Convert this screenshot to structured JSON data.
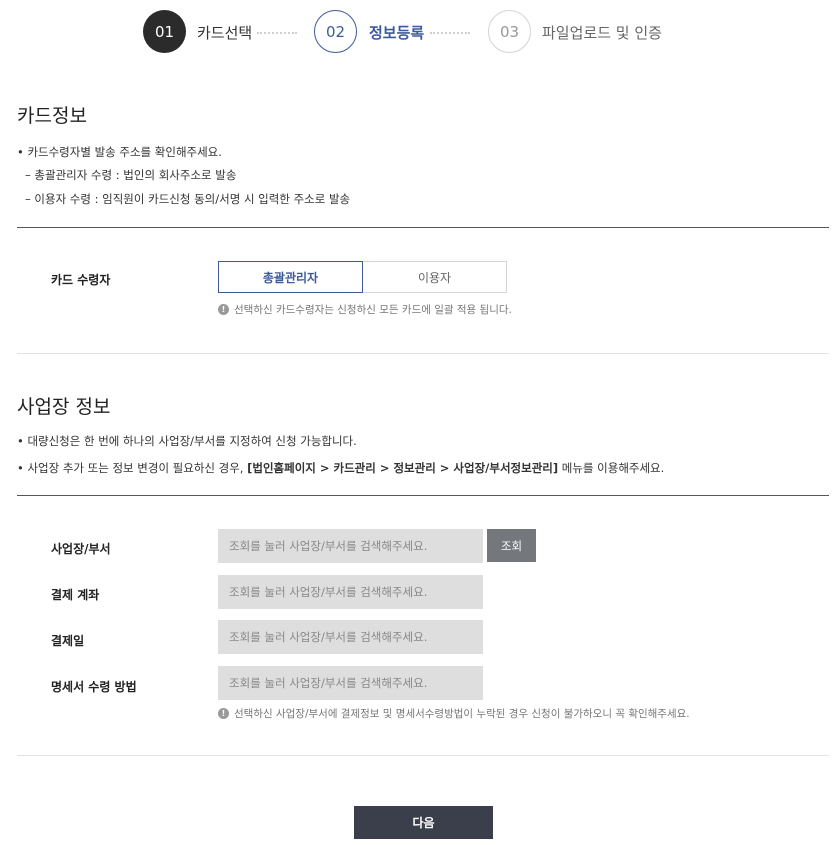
{
  "stepper": {
    "steps": [
      {
        "num": "01",
        "label": "카드선택",
        "state": "done"
      },
      {
        "num": "02",
        "label": "정보등록",
        "state": "active"
      },
      {
        "num": "03",
        "label": "파일업로드 및 인증",
        "state": "todo"
      }
    ]
  },
  "card_info": {
    "title": "카드정보",
    "notes": [
      "• 카드수령자별 발송 주소를 확인해주세요.",
      "– 총괄관리자 수령 : 법인의 회사주소로 발송",
      "– 이용자 수령 : 임직원이 카드신청 동의/서명 시 입력한 주소로 발송"
    ],
    "recipient_label": "카드 수령자",
    "options": [
      "총괄관리자",
      "이용자"
    ],
    "selected_option": "총괄관리자",
    "hint": "선택하신 카드수령자는 신청하신 모든 카드에 일괄 적용 됩니다."
  },
  "business_info": {
    "title": "사업장 정보",
    "note1": "• 대량신청은 한 번에 하나의 사업장/부서를 지정하여 신청 가능합니다.",
    "note2_prefix": "• 사업장 추가 또는 정보 변경이 필요하신 경우, ",
    "note2_path": "[법인홈페이지 > 카드관리 > 정보관리 > 사업장/부서정보관리]",
    "note2_suffix": " 메뉴를 이용해주세요.",
    "fields": [
      {
        "label": "사업장/부서",
        "placeholder": "조회를 눌러 사업장/부서를 검색해주세요."
      },
      {
        "label": "결제 계좌",
        "placeholder": "조회를 눌러 사업장/부서를 검색해주세요."
      },
      {
        "label": "결제일",
        "placeholder": "조회를 눌러 사업장/부서를 검색해주세요."
      },
      {
        "label": "명세서 수령 방법",
        "placeholder": "조회를 눌러 사업장/부서를 검색해주세요."
      }
    ],
    "search_label": "조회",
    "hint": "선택하신 사업장/부서에 결제정보 및 명세서수령방법이 누락된 경우 신청이 불가하오니 꼭 확인해주세요."
  },
  "next_button": "다음",
  "icons": {
    "info": "info-icon"
  },
  "colors": {
    "accent": "#3d5a99",
    "done": "#2b2b2b",
    "input_bg": "#dedede",
    "search_btn": "#74777b",
    "next_btn": "#3a3f4b"
  }
}
